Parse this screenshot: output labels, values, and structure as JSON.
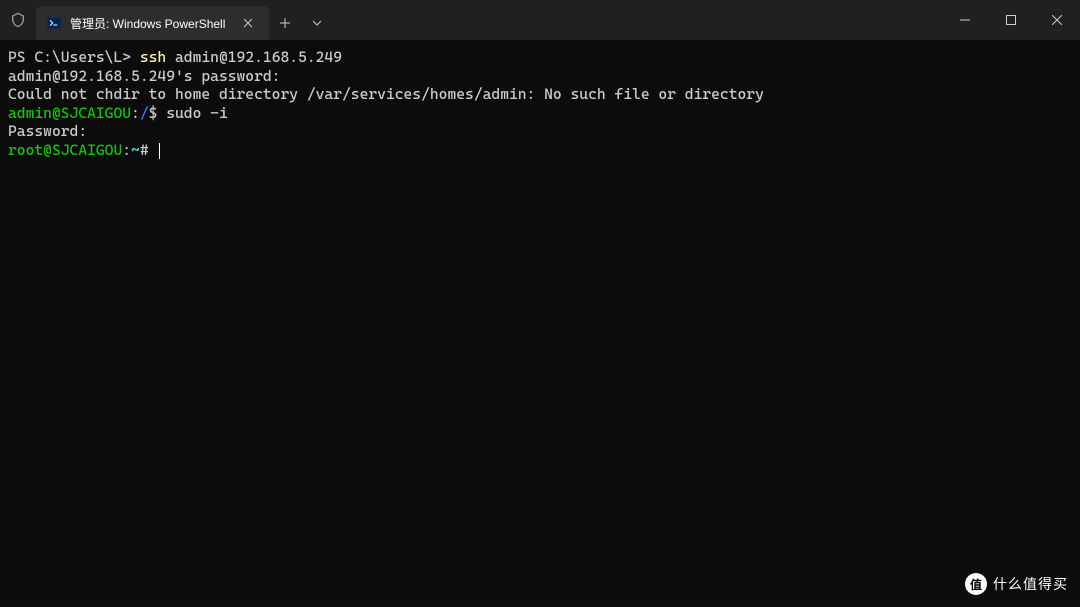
{
  "titlebar": {
    "tab_title": "管理员: Windows PowerShell",
    "close_glyph": "✕",
    "new_tab_glyph": "＋",
    "dropdown_glyph": "⌄"
  },
  "window_controls": {
    "minimize": "─",
    "maximize": "☐",
    "close": "✕"
  },
  "terminal": {
    "line1_prompt": "PS C:\\Users\\L> ",
    "line1_cmd_a": "ssh",
    "line1_cmd_b": " admin@192.168.5.249",
    "line2": "admin@192.168.5.249's password:",
    "line3": "Could not chdir to home directory /var/services/homes/admin: No such file or directory",
    "line4_user": "admin@SJCAIGOU",
    "line4_colon": ":",
    "line4_path": "/",
    "line4_dollar": "$ ",
    "line4_cmd": "sudo -i",
    "line5": "Password:",
    "line6_user": "root@SJCAIGOU",
    "line6_colon": ":",
    "line6_tilde": "~",
    "line6_hash": "# "
  },
  "watermark": {
    "badge": "值",
    "text": "什么值得买"
  },
  "colors": {
    "bg": "#0c0c0c",
    "prompt_green": "#16c60c",
    "path_blue": "#3b78ff",
    "tilde_cyan": "#61d6d6",
    "cmd_yellow": "#f9f1a5"
  }
}
